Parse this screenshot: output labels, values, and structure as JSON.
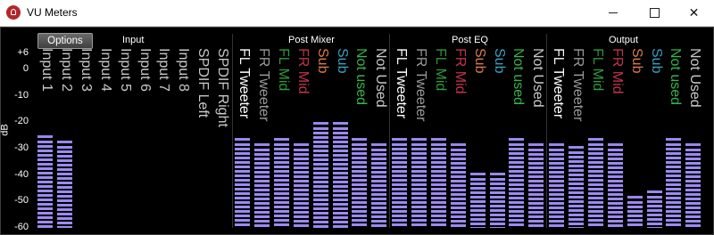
{
  "window": {
    "title": "VU Meters"
  },
  "options_label": "Options",
  "axis": {
    "unit": "dB",
    "ticks": [
      "+6",
      "0",
      "-10",
      "-20",
      "-30",
      "-40",
      "-50",
      "-60"
    ],
    "tick_values": [
      6,
      0,
      -10,
      -20,
      -30,
      -40,
      -50,
      -60
    ]
  },
  "sections": [
    {
      "title": "Input"
    },
    {
      "title": "Post Mixer"
    },
    {
      "title": "Post EQ"
    },
    {
      "title": "Output"
    }
  ],
  "colors": {
    "bar": "#9c8af0",
    "peak": "#9a86ee"
  },
  "chart_data": {
    "type": "bar",
    "ylabel": "dB",
    "ylim": [
      -60,
      6
    ],
    "groups": [
      {
        "name": "Input",
        "channels": [
          {
            "label": "Input 1",
            "color": "#c8c8c8",
            "value": -25
          },
          {
            "label": "Input 2",
            "color": "#c8c8c8",
            "value": -27
          },
          {
            "label": "Input 3",
            "color": "#c8c8c8",
            "value": null
          },
          {
            "label": "Input 4",
            "color": "#c8c8c8",
            "value": null
          },
          {
            "label": "Input 5",
            "color": "#c8c8c8",
            "value": null
          },
          {
            "label": "Input 6",
            "color": "#c8c8c8",
            "value": null
          },
          {
            "label": "Input 7",
            "color": "#c8c8c8",
            "value": null
          },
          {
            "label": "Input 8",
            "color": "#c8c8c8",
            "value": null
          },
          {
            "label": "SPDIF Left",
            "color": "#c8c8c8",
            "value": null
          },
          {
            "label": "SPDIF Right",
            "color": "#c8c8c8",
            "value": null
          }
        ]
      },
      {
        "name": "Post Mixer",
        "channels": [
          {
            "label": "FL Tweeter",
            "color": "#ffffff",
            "value": -26
          },
          {
            "label": "FR Tweeter",
            "color": "#9a9a9a",
            "value": -28
          },
          {
            "label": "FL Mid",
            "color": "#2f9a3a",
            "value": -26
          },
          {
            "label": "FR Mid",
            "color": "#c0344a",
            "value": -28
          },
          {
            "label": "Sub",
            "color": "#d97a48",
            "value": -20
          },
          {
            "label": "Sub",
            "color": "#37a0bf",
            "value": -20
          },
          {
            "label": "Not used",
            "color": "#36b34a",
            "value": -26
          },
          {
            "label": "Not Used",
            "color": "#c8c8c8",
            "value": -28
          }
        ]
      },
      {
        "name": "Post EQ",
        "channels": [
          {
            "label": "FL Tweeter",
            "color": "#ffffff",
            "value": -26
          },
          {
            "label": "FR Tweeter",
            "color": "#9a9a9a",
            "value": -26
          },
          {
            "label": "FL Mid",
            "color": "#2f9a3a",
            "value": -26
          },
          {
            "label": "FR Mid",
            "color": "#c0344a",
            "value": -28
          },
          {
            "label": "Sub",
            "color": "#d97a48",
            "value": -39
          },
          {
            "label": "Sub",
            "color": "#37a0bf",
            "value": -39
          },
          {
            "label": "Not used",
            "color": "#36b34a",
            "value": -26
          },
          {
            "label": "Not Used",
            "color": "#c8c8c8",
            "value": -28
          }
        ]
      },
      {
        "name": "Output",
        "channels": [
          {
            "label": "FL Tweeter",
            "color": "#ffffff",
            "value": -28
          },
          {
            "label": "FR Tweeter",
            "color": "#9a9a9a",
            "value": -29
          },
          {
            "label": "FL Mid",
            "color": "#2f9a3a",
            "value": -26
          },
          {
            "label": "FR Mid",
            "color": "#c0344a",
            "value": -28
          },
          {
            "label": "Sub",
            "color": "#d97a48",
            "value": -48
          },
          {
            "label": "Sub",
            "color": "#37a0bf",
            "value": -46
          },
          {
            "label": "Not used",
            "color": "#36b34a",
            "value": -26
          },
          {
            "label": "Not Used",
            "color": "#c8c8c8",
            "value": -28
          }
        ]
      }
    ]
  }
}
